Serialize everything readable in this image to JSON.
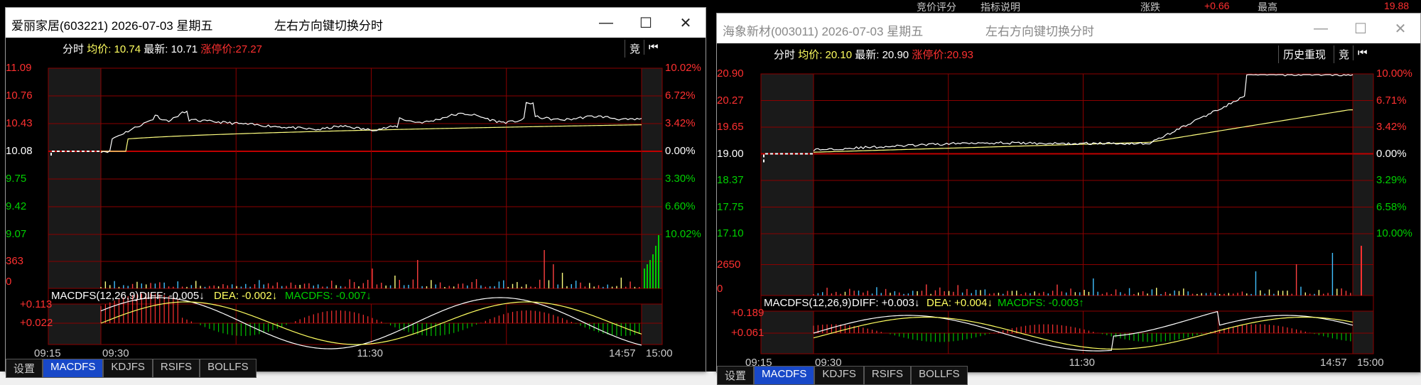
{
  "left": {
    "title": "爱丽家居(603221) 2026-07-03 星期五",
    "hint": "左右方向键切换分时",
    "hdr": {
      "fs": "分时",
      "avg_label": "均价:",
      "avg": "10.74",
      "last_label": "最新:",
      "last": "10.71",
      "limit_label": "涨停价:",
      "limit": "27.27"
    },
    "badge": "竞",
    "price_left": [
      "11.09",
      "10.76",
      "10.43",
      "10.08",
      "9.75",
      "9.42",
      "9.07"
    ],
    "pct_right": [
      "10.02%",
      "6.72%",
      "3.42%",
      "0.00%",
      "3.30%",
      "6.60%",
      "10.02%"
    ],
    "vol_left": [
      "363",
      "0"
    ],
    "macd_hdr": {
      "name": "MACDFS(12,26,9)",
      "diff": "DIFF: -0.005↓",
      "dea": "DEA: -0.002↓",
      "macdfs": "MACDFS: -0.007↓"
    },
    "macd_left": [
      "+0.113",
      "+0.022"
    ],
    "times": [
      "09:15",
      "09:30",
      "11:30",
      "14:57",
      "15:00"
    ],
    "tabs": [
      "设置",
      "MACDFS",
      "KDJFS",
      "RSIFS",
      "BOLLFS"
    ]
  },
  "right": {
    "title": "海象新材(003011) 2026-07-03 星期五",
    "hint": "左右方向键切换分时",
    "hdr": {
      "fs": "分时",
      "avg_label": "均价:",
      "avg": "20.10",
      "last_label": "最新:",
      "last": "20.90",
      "limit_label": "涨停价:",
      "limit": "20.93"
    },
    "hist_btn": "历史重现",
    "badge": "竞",
    "price_left": [
      "20.90",
      "20.27",
      "19.65",
      "19.00",
      "18.37",
      "17.75",
      "17.10"
    ],
    "pct_right": [
      "10.00%",
      "6.71%",
      "3.42%",
      "0.00%",
      "3.29%",
      "6.58%",
      "10.00%"
    ],
    "vol_left": [
      "2650",
      "0"
    ],
    "macd_hdr": {
      "name": "MACDFS(12,26,9)",
      "diff": "DIFF: +0.003↓",
      "dea": "DEA: +0.004↓",
      "macdfs": "MACDFS: -0.003↑"
    },
    "macd_left": [
      "+0.189",
      "+0.061"
    ],
    "times": [
      "09:15",
      "09:30",
      "11:30",
      "14:57",
      "15:00"
    ],
    "tabs": [
      "设置",
      "MACDFS",
      "KDJFS",
      "RSIFS",
      "BOLLFS"
    ]
  },
  "bg_frag": {
    "top1": "涨跌",
    "top2": "+0.66",
    "top3": "最高",
    "top4": "19.88",
    "top5": "竞价评分",
    "top6": "指标说明"
  },
  "colors": {
    "up": "#ff3030",
    "down": "#00d000",
    "price": "#ffffff",
    "avg": "#ffff80",
    "grid": "#8b0000"
  }
}
